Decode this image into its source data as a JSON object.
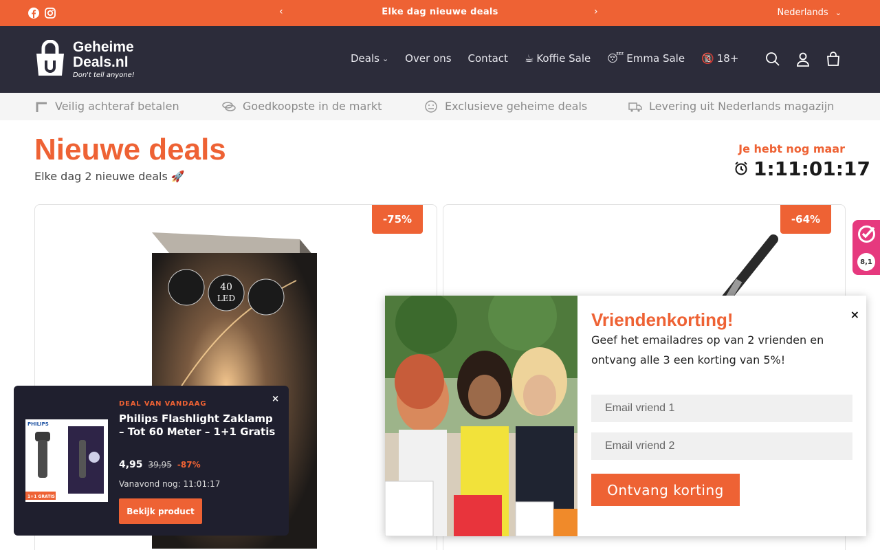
{
  "announcement": {
    "message": "Elke dag nieuwe deals",
    "language": "Nederlands",
    "social": [
      "facebook-icon",
      "instagram-icon"
    ]
  },
  "header": {
    "brand_line1": "Geheime",
    "brand_line2": "Deals.nl",
    "tagline": "Don't tell anyone!",
    "nav": [
      {
        "label": "Deals",
        "icon": "chevron-down-icon"
      },
      {
        "label": "Over ons"
      },
      {
        "label": "Contact"
      },
      {
        "label": "Koffie Sale",
        "icon": "coffee-icon"
      },
      {
        "label": "Emma Sale",
        "icon": "sleepy-face-icon"
      },
      {
        "label": "18+",
        "icon": "no-under-18-icon"
      }
    ],
    "icons": [
      "search-icon",
      "account-icon",
      "cart-icon"
    ]
  },
  "usp": [
    {
      "label": "Veilig achteraf betalen",
      "icon": "klarna-icon"
    },
    {
      "label": "Goedkoopste in de markt",
      "icon": "coins-icon"
    },
    {
      "label": "Exclusieve geheime deals",
      "icon": "secret-face-icon"
    },
    {
      "label": "Levering uit Nederlands magazijn",
      "icon": "truck-icon"
    }
  ],
  "main": {
    "title": "Nieuwe deals",
    "subtitle": "Elke dag 2 nieuwe deals 🚀",
    "countdown_label": "Je hebt nog maar",
    "countdown": "1:11:01:17"
  },
  "products": [
    {
      "discount": "-75%",
      "image": "led-string-lights-box"
    },
    {
      "discount": "-64%",
      "image": "telescopic-tool"
    }
  ],
  "kiyoh": {
    "score": "8,1"
  },
  "friend_popup": {
    "title": "Vriendenkorting!",
    "description": "Geef het emailadres op van 2 vrienden en ontvang alle 3 een korting van 5%!",
    "email1_placeholder": "Email vriend 1",
    "email2_placeholder": "Email vriend 2",
    "button": "Ontvang korting",
    "close": "×"
  },
  "deal_popup": {
    "kicker": "DEAL VAN VANDAAG",
    "name": "Philips Flashlight Zaklamp – Tot 60 Meter – 1+1 Gratis",
    "price": "4,95",
    "old_price": "39,95",
    "discount": "-87%",
    "timer": "Vanavond nog: 11:01:17",
    "button": "Bekijk product",
    "thumb_badge": "1+1 GRATIS",
    "thumb_brand": "PHILIPS",
    "close": "×"
  },
  "colors": {
    "accent": "#ee6234",
    "header_bg": "#2c2c3a",
    "deal_bg": "#1f1f2e",
    "kiyoh": "#e6397e"
  }
}
